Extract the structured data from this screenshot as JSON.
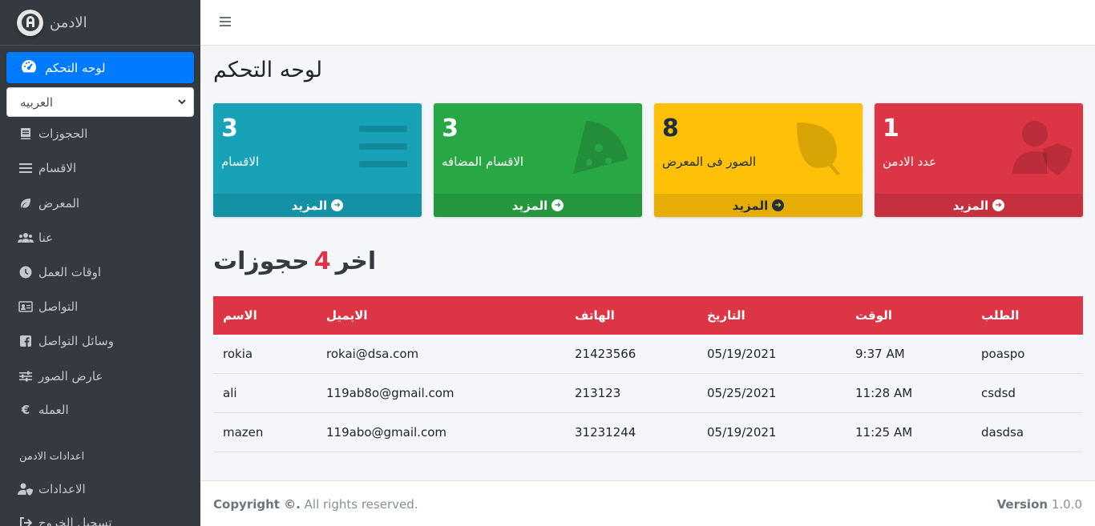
{
  "brand": {
    "title": "الادمن"
  },
  "sidebar": {
    "active": {
      "label": "لوحه التحكم",
      "icon": "tachometer-icon"
    },
    "language_select": {
      "value": "العربيه"
    },
    "items": [
      {
        "label": "الحجوزات",
        "icon": "book-icon"
      },
      {
        "label": "الاقسام",
        "icon": "bars-icon"
      },
      {
        "label": "المعرض",
        "icon": "leaf-icon"
      },
      {
        "label": "عنا",
        "icon": "users-icon"
      },
      {
        "label": "اوقات العمل",
        "icon": "clock-icon"
      },
      {
        "label": "التواصل",
        "icon": "id-card-icon"
      },
      {
        "label": "وسائل التواصل",
        "icon": "facebook-icon"
      },
      {
        "label": "عارض الصور",
        "icon": "sliders-icon"
      },
      {
        "label": "العمله",
        "icon": "euro-icon"
      }
    ],
    "settings_header": "اعدادات الادمن",
    "settings_items": [
      {
        "label": "الاعدادات",
        "icon": "user-shield-icon"
      },
      {
        "label": "تسجيل الخروج",
        "icon": "sign-out-icon"
      }
    ]
  },
  "page": {
    "title": "لوحه التحكم"
  },
  "boxes": [
    {
      "value": "3",
      "label": "الاقسام",
      "more": "المزيد",
      "icon": "bars-icon",
      "color": "#17a2b8"
    },
    {
      "value": "3",
      "label": "الاقسام المضافه",
      "more": "المزيد",
      "icon": "pizza-slice-icon",
      "color": "#28a745"
    },
    {
      "value": "8",
      "label": "الصور فى المعرض",
      "more": "المزيد",
      "icon": "leaf-icon",
      "color": "#ffc107"
    },
    {
      "value": "1",
      "label": "عدد الادمن",
      "more": "المزيد",
      "icon": "user-shield-icon",
      "color": "#dc3545"
    }
  ],
  "bookings": {
    "title_prefix": "اخر",
    "count": "4",
    "title_suffix": "حجوزات",
    "columns": [
      "الاسم",
      "الايميل",
      "الهاتف",
      "التاريخ",
      "الوقت",
      "الطلب"
    ],
    "rows": [
      [
        "rokia",
        "rokai@dsa.com",
        "21423566",
        "05/19/2021",
        "9:37 AM",
        "poaspo"
      ],
      [
        "ali",
        "119ab8o@gmail.com",
        "213123",
        "05/25/2021",
        "11:28 AM",
        "csdsd"
      ],
      [
        "mazen",
        "119abo@gmail.com",
        "31231244",
        "05/19/2021",
        "11:25 AM",
        "dasdsa"
      ]
    ]
  },
  "footer": {
    "copyright_bold": "Copyright ©.",
    "copyright_rest": " All rights reserved.",
    "version_label": "Version",
    "version_value": " 1.0.0"
  }
}
